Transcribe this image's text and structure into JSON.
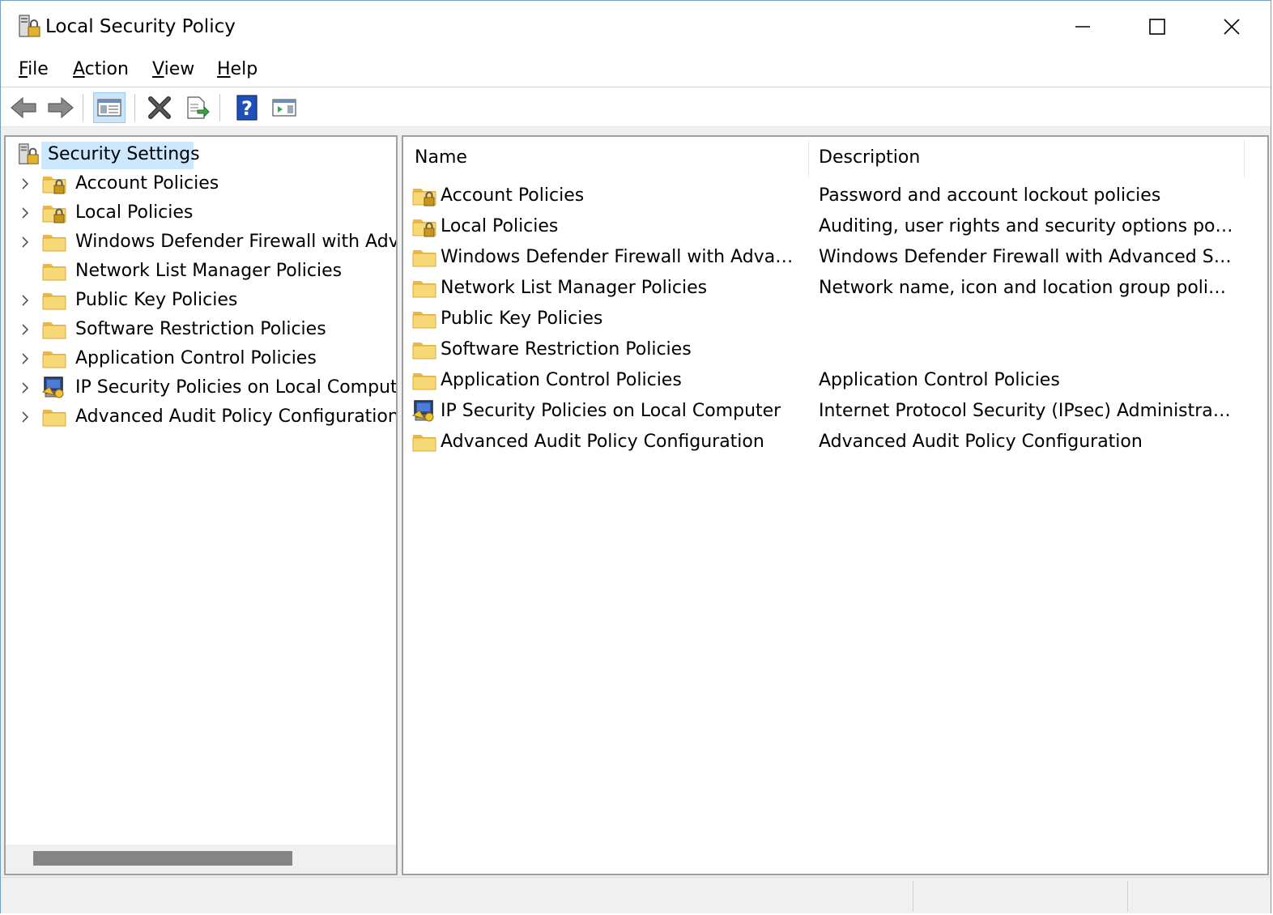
{
  "window": {
    "title": "Local Security Policy"
  },
  "menu": {
    "items": [
      "File",
      "Action",
      "View",
      "Help"
    ]
  },
  "toolbar": {
    "buttons": [
      "back-icon",
      "forward-icon",
      "show-hide-console-tree-icon",
      "delete-icon",
      "export-list-icon",
      "help-icon",
      "show-action-pane-icon"
    ]
  },
  "tree": {
    "root": "Security Settings",
    "items": [
      {
        "label": "Account Policies",
        "icon": "lock-folder",
        "expandable": true
      },
      {
        "label": "Local Policies",
        "icon": "lock-folder",
        "expandable": true
      },
      {
        "label": "Windows Defender Firewall with Advai",
        "icon": "folder",
        "expandable": true
      },
      {
        "label": "Network List Manager Policies",
        "icon": "folder",
        "expandable": false
      },
      {
        "label": "Public Key Policies",
        "icon": "folder",
        "expandable": true
      },
      {
        "label": "Software Restriction Policies",
        "icon": "folder",
        "expandable": true
      },
      {
        "label": "Application Control Policies",
        "icon": "folder",
        "expandable": true
      },
      {
        "label": "IP Security Policies on Local Computer",
        "icon": "ipsec",
        "expandable": true
      },
      {
        "label": "Advanced Audit Policy Configuration",
        "icon": "folder",
        "expandable": true
      }
    ]
  },
  "list": {
    "columns": [
      "Name",
      "Description"
    ],
    "rows": [
      {
        "name": "Account Policies",
        "description": "Password and account lockout policies",
        "icon": "lock-folder"
      },
      {
        "name": "Local Policies",
        "description": "Auditing, user rights and security options policies",
        "icon": "lock-folder"
      },
      {
        "name": "Windows Defender Firewall with Advance...",
        "description": "Windows Defender Firewall with Advanced Secu...",
        "icon": "folder"
      },
      {
        "name": "Network List Manager Policies",
        "description": "Network name, icon and location group policies.",
        "icon": "folder"
      },
      {
        "name": "Public Key Policies",
        "description": "",
        "icon": "folder"
      },
      {
        "name": "Software Restriction Policies",
        "description": "",
        "icon": "folder"
      },
      {
        "name": "Application Control Policies",
        "description": "Application Control Policies",
        "icon": "folder"
      },
      {
        "name": "IP Security Policies on Local Computer",
        "description": "Internet Protocol Security (IPsec) Administration. ...",
        "icon": "ipsec"
      },
      {
        "name": "Advanced Audit Policy Configuration",
        "description": "Advanced Audit Policy Configuration",
        "icon": "folder"
      }
    ]
  },
  "colors": {
    "selection": "#cce8ff",
    "folder": "#f6d87a",
    "border": "#a0a0a0"
  }
}
